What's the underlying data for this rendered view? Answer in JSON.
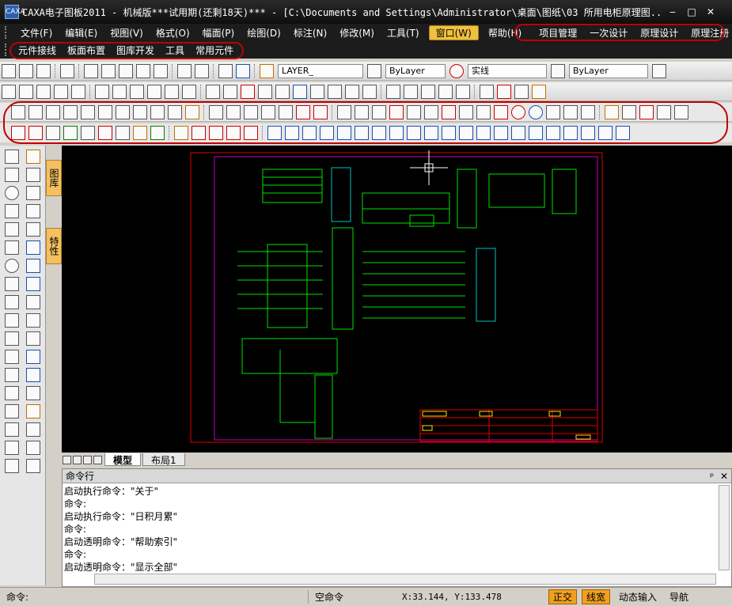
{
  "window": {
    "title": "CAXA电子图板2011 - 机械版***试用期(还剩18天)*** - [C:\\Documents and Settings\\Administrator\\桌面\\图纸\\03 所用电柜原理图...",
    "app_icon_text": "CAXA",
    "minimize": "‒",
    "maximize": "□",
    "close": "✕"
  },
  "menu": {
    "items": [
      "文件(F)",
      "编辑(E)",
      "视图(V)",
      "格式(O)",
      "幅面(P)",
      "绘图(D)",
      "标注(N)",
      "修改(M)",
      "工具(T)",
      "窗口(W)",
      "帮助(H)"
    ],
    "active": "窗口(W)",
    "extra_items": [
      "项目管理",
      "一次设计",
      "原理设计",
      "原理注册"
    ]
  },
  "menu2": {
    "items": [
      "元件接线",
      "板面布置",
      "图库开发",
      "工具",
      "常用元件"
    ]
  },
  "properties": {
    "layer": "LAYER_",
    "color": "ByLayer",
    "linetype": "实线",
    "lineweight": "ByLayer"
  },
  "side_tabs": [
    "图库",
    "特性"
  ],
  "layout_tabs": [
    "模型",
    "布局1"
  ],
  "active_layout_tab": "模型",
  "command_panel": {
    "title": "命令行",
    "pin": "ᵖ",
    "close": "✕",
    "lines": [
      "启动执行命令：\"关于\"",
      "命令:",
      "启动执行命令：\"日积月累\"",
      "命令:",
      "启动透明命令：\"帮助索引\"",
      "命令:",
      "启动透明命令：\"显示全部\""
    ]
  },
  "status": {
    "prompt": "命令:",
    "state": "空命令",
    "coords": "X:33.144, Y:133.478",
    "toggles": [
      "正交",
      "线宽"
    ],
    "dynamic_input": "动态输入",
    "nav": "导航"
  }
}
